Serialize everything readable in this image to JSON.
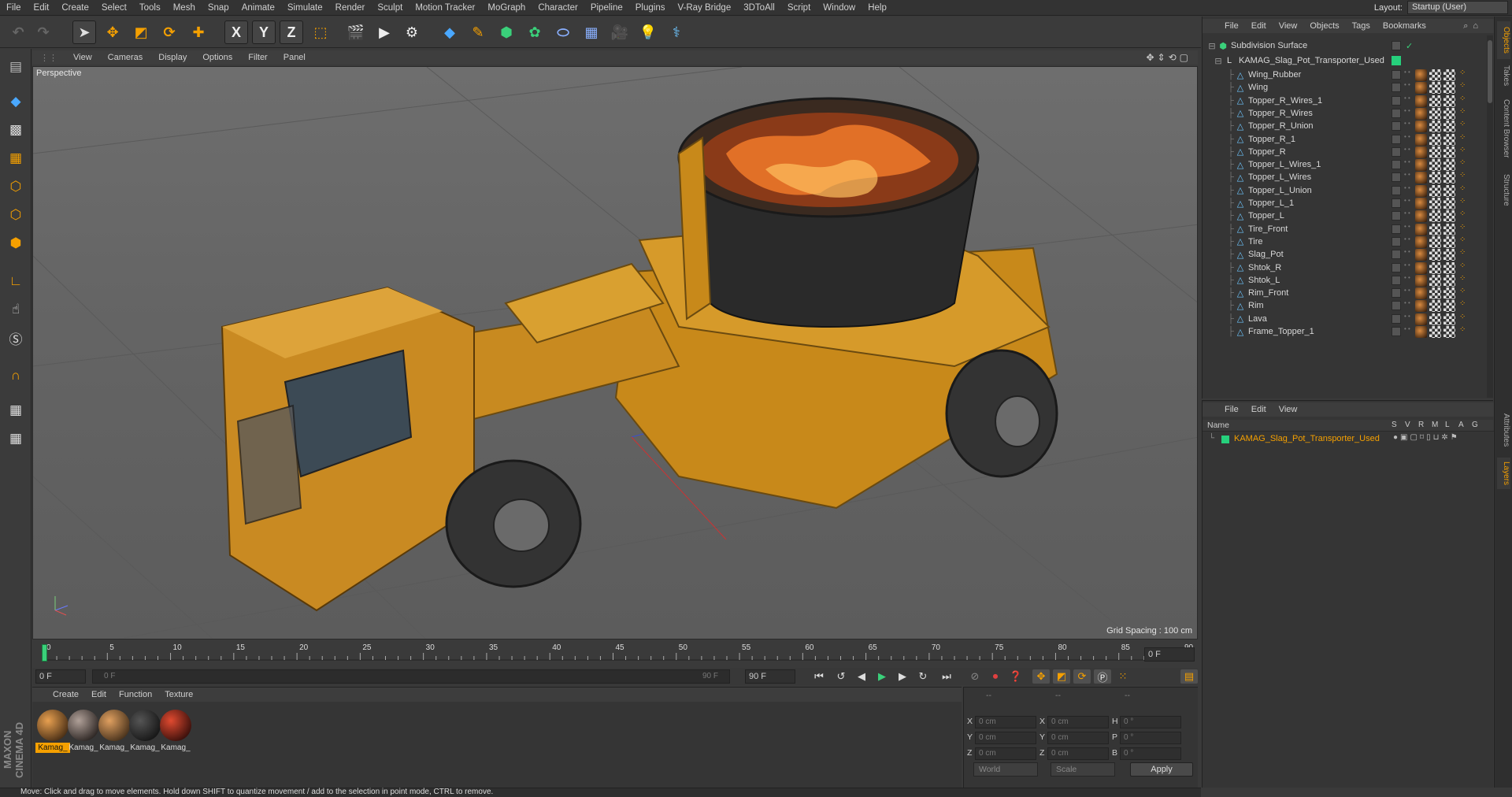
{
  "menubar": {
    "items": [
      "File",
      "Edit",
      "Create",
      "Select",
      "Tools",
      "Mesh",
      "Snap",
      "Animate",
      "Simulate",
      "Render",
      "Sculpt",
      "Motion Tracker",
      "MoGraph",
      "Character",
      "Pipeline",
      "Plugins",
      "V-Ray Bridge",
      "3DToAll",
      "Script",
      "Window",
      "Help"
    ],
    "layout_label": "Layout:",
    "layout_value": "Startup (User)"
  },
  "toolbar": {
    "axis_x": "X",
    "axis_y": "Y",
    "axis_z": "Z"
  },
  "viewport": {
    "menu": [
      "View",
      "Cameras",
      "Display",
      "Options",
      "Filter",
      "Panel"
    ],
    "camera_label": "Perspective",
    "grid_spacing": "Grid Spacing : 100 cm"
  },
  "timeline": {
    "ticks": [
      "0",
      "5",
      "10",
      "15",
      "20",
      "25",
      "30",
      "35",
      "40",
      "45",
      "50",
      "55",
      "60",
      "65",
      "70",
      "75",
      "80",
      "85",
      "90"
    ],
    "current_frame_right": "0 F",
    "start_field": "0 F",
    "range_start": "0 F",
    "range_end": "90 F",
    "end_field": "90 F"
  },
  "materials": {
    "menu": [
      "Create",
      "Edit",
      "Function",
      "Texture"
    ],
    "items": [
      {
        "name": "Kamag_",
        "color1": "#e8a050",
        "color2": "#3a2410",
        "selected": true
      },
      {
        "name": "Kamag_",
        "color1": "#b0a098",
        "color2": "#201a18",
        "selected": false
      },
      {
        "name": "Kamag_",
        "color1": "#e0a060",
        "color2": "#3a2816",
        "selected": false
      },
      {
        "name": "Kamag_",
        "color1": "#555555",
        "color2": "#101010",
        "selected": false
      },
      {
        "name": "Kamag_",
        "color1": "#e04a30",
        "color2": "#2a0a08",
        "selected": false
      }
    ]
  },
  "coords": {
    "header_left": "--",
    "header_mid": "--",
    "header_right": "--",
    "rows": [
      {
        "l1": "X",
        "v1": "0 cm",
        "l2": "X",
        "v2": "0 cm",
        "l3": "H",
        "v3": "0 °"
      },
      {
        "l1": "Y",
        "v1": "0 cm",
        "l2": "Y",
        "v2": "0 cm",
        "l3": "P",
        "v3": "0 °"
      },
      {
        "l1": "Z",
        "v1": "0 cm",
        "l2": "Z",
        "v2": "0 cm",
        "l3": "B",
        "v3": "0 °"
      }
    ],
    "mode1": "World",
    "mode2": "Scale",
    "apply": "Apply"
  },
  "status": "Move: Click and drag to move elements. Hold down SHIFT to quantize movement / add to the selection in point mode, CTRL to remove.",
  "brand": "MAXON CINEMA 4D",
  "objects": {
    "menu": [
      "File",
      "Edit",
      "View",
      "Objects",
      "Tags",
      "Bookmarks"
    ],
    "root": "Subdivision Surface",
    "group": "KAMAG_Slag_Pot_Transporter_Used",
    "children": [
      "Wing_Rubber",
      "Wing",
      "Topper_R_Wires_1",
      "Topper_R_Wires",
      "Topper_R_Union",
      "Topper_R_1",
      "Topper_R",
      "Topper_L_Wires_1",
      "Topper_L_Wires",
      "Topper_L_Union",
      "Topper_L_1",
      "Topper_L",
      "Tire_Front",
      "Tire",
      "Slag_Pot",
      "Shtok_R",
      "Shtok_L",
      "Rim_Front",
      "Rim",
      "Lava",
      "Frame_Topper_1"
    ]
  },
  "layers": {
    "menu": [
      "File",
      "Edit",
      "View"
    ],
    "col_name": "Name",
    "cols": [
      "S",
      "V",
      "R",
      "M",
      "L",
      "A",
      "G"
    ],
    "row_name": "KAMAG_Slag_Pot_Transporter_Used",
    "row_color": "#26d07c"
  },
  "sidetabs": [
    "Objects",
    "Takes",
    "Content Browser",
    "Structure",
    "Attributes",
    "Layers"
  ],
  "colors": {
    "accent": "#f5a000",
    "layer_green": "#26d07c",
    "icon_blue": "#6ec6ff"
  }
}
